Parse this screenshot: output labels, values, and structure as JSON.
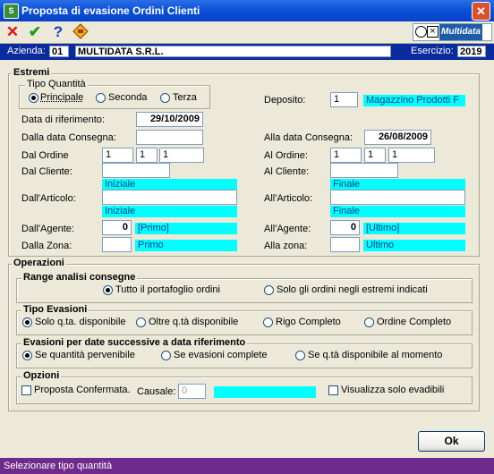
{
  "window": {
    "title": "Proposta di evasione Ordini Clienti",
    "icon_label": "S"
  },
  "toolbar": {
    "icons": [
      "cancel-icon",
      "confirm-icon",
      "help-icon",
      "wizard-icon"
    ],
    "logo_text": "Multidata"
  },
  "header": {
    "azienda_label": "Azienda:",
    "azienda_code": "01",
    "azienda_name": "MULTIDATA S.R.L.",
    "esercizio_label": "Esercizio:",
    "esercizio_value": "2019"
  },
  "estremi": {
    "title": "Estremi",
    "tipo_quantita": {
      "title": "Tipo Quantità",
      "options": [
        "Principale",
        "Seconda",
        "Terza"
      ],
      "selected": "Principale"
    },
    "deposito": {
      "label": "Deposito:",
      "code": "1",
      "name": "Magazzino Prodotti F"
    },
    "data_riferimento": {
      "label": "Data di riferimento:",
      "value": "29/10/2009"
    },
    "dalla_data_consegna": {
      "label": "Dalla data Consegna:",
      "value": ""
    },
    "alla_data_consegna": {
      "label": "Alla data Consegna:",
      "value": "26/08/2009"
    },
    "dal_ordine": {
      "label": "Dal Ordine",
      "values": [
        "1",
        "1",
        "1"
      ]
    },
    "al_ordine": {
      "label": "Al Ordine:",
      "values": [
        "1",
        "1",
        "1"
      ]
    },
    "dal_cliente": {
      "label": "Dal Cliente:",
      "value": "",
      "desc": "Iniziale"
    },
    "al_cliente": {
      "label": "Al Cliente:",
      "value": "",
      "desc": "Finale"
    },
    "dall_articolo": {
      "label": "Dall'Articolo:",
      "value": "",
      "desc": "Iniziale"
    },
    "all_articolo": {
      "label": "All'Articolo:",
      "value": "",
      "desc": "Finale"
    },
    "dall_agente": {
      "label": "Dall'Agente:",
      "value": "0",
      "desc": "[Primo]"
    },
    "all_agente": {
      "label": "All'Agente:",
      "value": "0",
      "desc": "[Ultimo]"
    },
    "dalla_zona": {
      "label": "Dalla Zona:",
      "value": "",
      "desc": "Primo"
    },
    "alla_zona": {
      "label": "Alla zona:",
      "value": "",
      "desc": "Ultimo"
    }
  },
  "operazioni": {
    "title": "Operazioni",
    "range": {
      "title": "Range analisi consegne",
      "options": [
        "Tutto il portafoglio ordini",
        "Solo gli ordini negli estremi indicati"
      ],
      "selected": "Tutto il portafoglio ordini"
    },
    "tipo_evasioni": {
      "title": "Tipo Evasioni",
      "options": [
        "Solo q.ta. disponibile",
        "Oltre q.tà disponibile",
        "Rigo Completo",
        "Ordine Completo"
      ],
      "selected": "Solo q.ta. disponibile"
    },
    "evasioni_date": {
      "title": "Evasioni per date successive a data riferimento",
      "options": [
        "Se quantità pervenibile",
        "Se evasioni complete",
        "Se q.tà disponibile al momento"
      ],
      "selected": "Se quantità pervenibile"
    },
    "opzioni": {
      "title": "Opzioni",
      "proposta_label": "Proposta Confermata.",
      "proposta_checked": false,
      "causale_label": "Causale:",
      "causale_value": "0",
      "visualizza_label": "Visualizza solo evadibili",
      "visualizza_checked": false
    }
  },
  "ok_button": "Ok",
  "status_text": "Selezionare tipo quantità"
}
